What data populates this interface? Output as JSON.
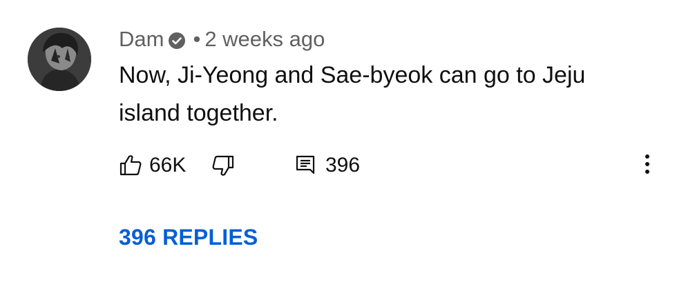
{
  "comment": {
    "author": "Dam",
    "verified_icon": "verified-check-icon",
    "separator": "•",
    "timestamp": "2 weeks ago",
    "text": "Now, Ji-Yeong and Sae-byeok can go to Jeju island together.",
    "avatar_icon": "avatar-image"
  },
  "actions": {
    "like_icon": "thumbs-up-icon",
    "like_count": "66K",
    "dislike_icon": "thumbs-down-icon",
    "reply_icon": "comment-icon",
    "reply_count": "396",
    "more_icon": "more-vertical-icon"
  },
  "replies": {
    "label": "396 REPLIES"
  },
  "colors": {
    "text_primary": "#0f0f0f",
    "text_secondary": "#606060",
    "link_blue": "#065fd4",
    "background": "#ffffff"
  }
}
